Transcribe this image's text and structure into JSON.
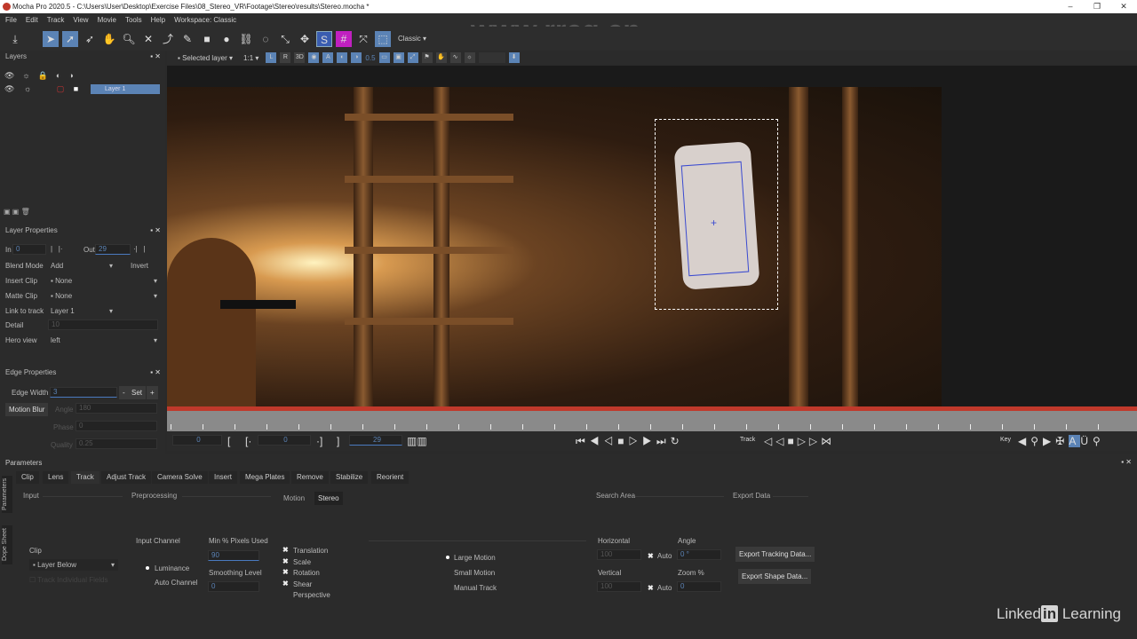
{
  "window": {
    "title": "Mocha Pro 2020.5 - C:\\Users\\User\\Desktop\\Exercise Files\\08_Stereo_VR\\Footage\\Stereo\\results\\Stereo.mocha *"
  },
  "menu": [
    "File",
    "Edit",
    "Track",
    "View",
    "Movie",
    "Tools",
    "Help",
    "Workspace: Classic"
  ],
  "toolbar": {
    "workspace_select": "Classic"
  },
  "watermark": "www.rrcg.cn",
  "layers": {
    "title": "Layers",
    "items": [
      {
        "name": "Layer 1"
      }
    ]
  },
  "viewer_bar": {
    "layer_select": "Selected layer",
    "zoom": "1:1",
    "r": "R",
    "three_d": "3D",
    "a": "A",
    "opacity": "0.5"
  },
  "layer_properties": {
    "title": "Layer Properties",
    "in_label": "In",
    "in_value": "0",
    "out_label": "Out",
    "out_value": "29",
    "blend_mode_label": "Blend Mode",
    "blend_mode": "Add",
    "invert": "Invert",
    "insert_clip_label": "Insert Clip",
    "insert_clip": "None",
    "matte_clip_label": "Matte Clip",
    "matte_clip": "None",
    "link_label": "Link to track",
    "link_value": "Layer 1",
    "detail_label": "Detail",
    "detail_value": "10",
    "hero_label": "Hero view",
    "hero_value": "left"
  },
  "edge_properties": {
    "title": "Edge Properties",
    "edge_width_label": "Edge Width",
    "edge_width": "3",
    "minus": "-",
    "set": "Set",
    "plus": "+",
    "motion_blur": "Motion Blur",
    "angle_label": "Angle",
    "angle_value": "180",
    "phase_label": "Phase",
    "phase_value": "0",
    "quality_label": "Quality",
    "quality_value": "0.25"
  },
  "transport": {
    "current_frame": "0",
    "in_frame": "0",
    "out_frame": "29",
    "track_label": "Track",
    "key_label": "Key"
  },
  "parameters": {
    "title": "Parameters",
    "side_tabs": [
      "Parameters",
      "Dope Sheet"
    ],
    "tabs": [
      "Clip",
      "Lens",
      "Track",
      "Adjust Track",
      "Camera Solve",
      "Insert",
      "Mega Plates",
      "Remove",
      "Stabilize",
      "Reorient"
    ],
    "sections": {
      "input": "Input",
      "preprocessing": "Preprocessing",
      "motion": "Motion",
      "stereo": "Stereo",
      "search_area": "Search Area",
      "export_data": "Export Data"
    },
    "clip_label": "Clip",
    "clip_value": "Layer Below",
    "track_individual": "Track Individual Fields",
    "input_channel_label": "Input Channel",
    "luminance": "Luminance",
    "auto_channel": "Auto Channel",
    "min_pixels_label": "Min % Pixels Used",
    "min_pixels_value": "90",
    "smoothing_label": "Smoothing Level",
    "smoothing_value": "0",
    "motion_options": [
      {
        "label": "Translation",
        "checked": true
      },
      {
        "label": "Scale",
        "checked": true
      },
      {
        "label": "Rotation",
        "checked": true
      },
      {
        "label": "Shear",
        "checked": true
      },
      {
        "label": "Perspective",
        "checked": false
      }
    ],
    "tracking_modes": [
      {
        "label": "Large Motion",
        "selected": true
      },
      {
        "label": "Small Motion",
        "selected": false
      },
      {
        "label": "Manual Track",
        "selected": false
      }
    ],
    "horizontal_label": "Horizontal",
    "horizontal_value": "100",
    "vertical_label": "Vertical",
    "vertical_value": "100",
    "auto": "Auto",
    "angle_label": "Angle",
    "angle_value": "0 °",
    "zoom_label": "Zoom %",
    "zoom_value": "0",
    "export_tracking": "Export Tracking Data...",
    "export_shape": "Export Shape Data..."
  },
  "branding": {
    "linkedin_a": "Linked",
    "linkedin_in": "in",
    "linkedin_b": "Learning"
  }
}
